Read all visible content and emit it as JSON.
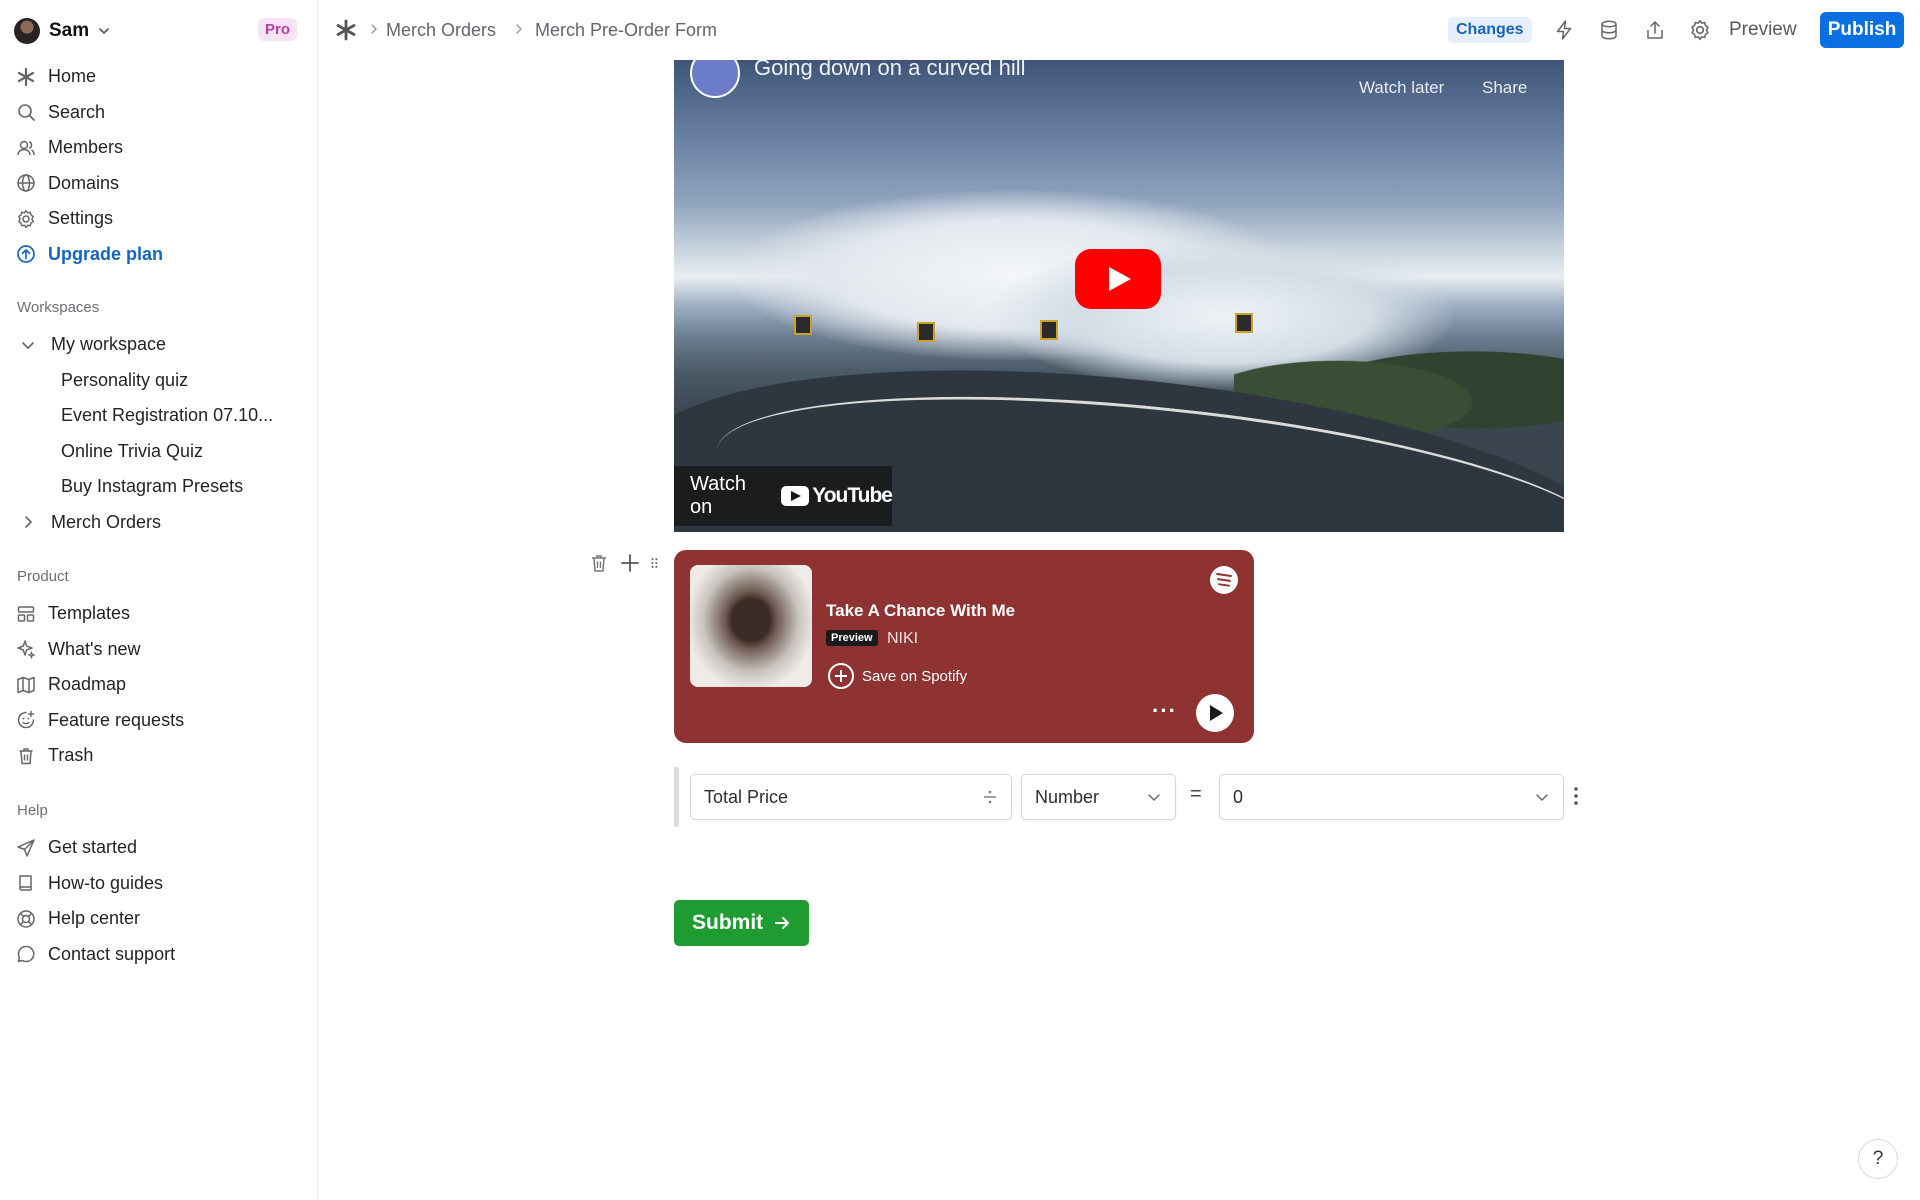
{
  "user": {
    "name": "Sam",
    "plan_badge": "Pro"
  },
  "sidebar": {
    "main_items": [
      {
        "label": "Home",
        "icon": "asterisk-icon"
      },
      {
        "label": "Search",
        "icon": "search-icon"
      },
      {
        "label": "Members",
        "icon": "members-icon"
      },
      {
        "label": "Domains",
        "icon": "globe-icon"
      },
      {
        "label": "Settings",
        "icon": "gear-icon"
      },
      {
        "label": "Upgrade plan",
        "icon": "upgrade-icon"
      }
    ],
    "workspaces_title": "Workspaces",
    "my_workspace": {
      "label": "My workspace",
      "items": [
        "Personality quiz",
        "Event Registration 07.10...",
        "Online Trivia Quiz",
        "Buy Instagram Presets"
      ]
    },
    "merch_orders": {
      "label": "Merch Orders"
    },
    "product_title": "Product",
    "product_items": [
      {
        "label": "Templates",
        "icon": "templates-icon"
      },
      {
        "label": "What's new",
        "icon": "sparkle-icon"
      },
      {
        "label": "Roadmap",
        "icon": "map-icon"
      },
      {
        "label": "Feature requests",
        "icon": "feature-request-icon"
      },
      {
        "label": "Trash",
        "icon": "trash-icon"
      }
    ],
    "help_title": "Help",
    "help_items": [
      {
        "label": "Get started",
        "icon": "send-icon"
      },
      {
        "label": "How-to guides",
        "icon": "book-icon"
      },
      {
        "label": "Help center",
        "icon": "lifebuoy-icon"
      },
      {
        "label": "Contact support",
        "icon": "chat-icon"
      }
    ]
  },
  "topbar": {
    "breadcrumb": [
      "Merch Orders",
      "Merch Pre-Order Form"
    ],
    "changes_label": "Changes",
    "preview_label": "Preview",
    "publish_label": "Publish"
  },
  "video": {
    "title": "Going down on a curved hill",
    "watch_later": "Watch later",
    "share": "Share",
    "watch_on": "Watch on",
    "platform": "YouTube"
  },
  "spotify": {
    "track": "Take A Chance With Me",
    "preview_badge": "Preview",
    "artist": "NIKI",
    "save_label": "Save on Spotify"
  },
  "calculation": {
    "variable": "Total Price",
    "type": "Number",
    "operator": "=",
    "value": "0"
  },
  "form": {
    "submit_label": "Submit"
  },
  "help_button": "?"
}
